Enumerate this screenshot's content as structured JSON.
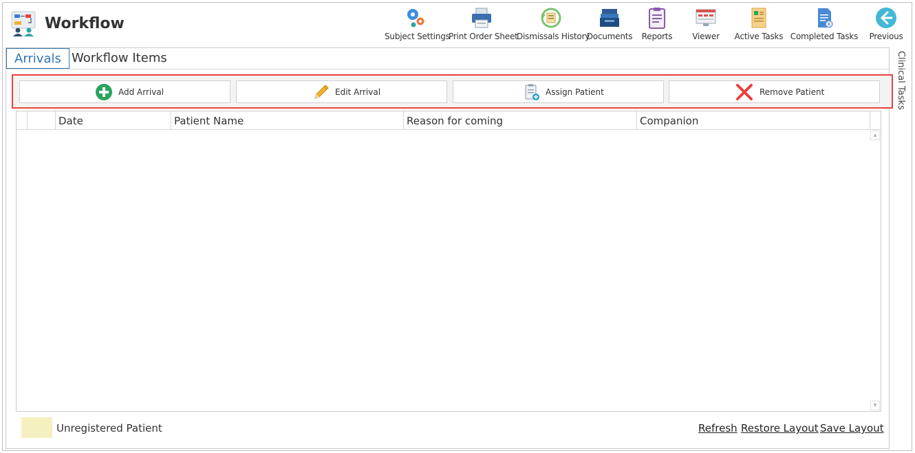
{
  "app": {
    "title": "Workflow",
    "logo_icon": "workflow-logo-icon"
  },
  "toolbar": {
    "items": [
      {
        "label": "Subject Settings",
        "icon": "gears-icon"
      },
      {
        "label": "Print Order Sheet",
        "icon": "printer-icon"
      },
      {
        "label": "Dismissals History",
        "icon": "history-icon"
      },
      {
        "label": "Documents",
        "icon": "inbox-tray-icon"
      },
      {
        "label": "Reports",
        "icon": "clipboard-icon"
      },
      {
        "label": "Viewer",
        "icon": "monitor-icon"
      },
      {
        "label": "Active Tasks",
        "icon": "active-tasks-icon"
      },
      {
        "label": "Completed Tasks",
        "icon": "completed-tasks-icon"
      },
      {
        "label": "Previous",
        "icon": "back-arrow-icon"
      }
    ]
  },
  "tabs": [
    {
      "label": "Arrivals",
      "active": true
    },
    {
      "label": "Workflow Items",
      "active": false
    }
  ],
  "actions": [
    {
      "label": "Add Arrival",
      "icon": "plus-circle-icon",
      "color": "#2aa45b"
    },
    {
      "label": "Edit Arrival",
      "icon": "pencil-icon",
      "color": "#f2b12c"
    },
    {
      "label": "Assign Patient",
      "icon": "clipboard-add-icon",
      "color": "#2f9fc7"
    },
    {
      "label": "Remove Patient",
      "icon": "x-icon",
      "color": "#e8413c"
    }
  ],
  "grid": {
    "columns": [
      "",
      "",
      "Date",
      "Patient Name",
      "Reason for coming",
      "Companion"
    ],
    "rows": []
  },
  "footer": {
    "legend_label": "Unregistered Patient",
    "legend_color": "#f5f0bf",
    "links": [
      "Refresh",
      "Restore Layout",
      "Save Layout"
    ]
  },
  "side_panel": {
    "label": "Clinical Tasks"
  },
  "colors": {
    "accent": "#2f74b5",
    "highlight_border": "#e8413c"
  }
}
